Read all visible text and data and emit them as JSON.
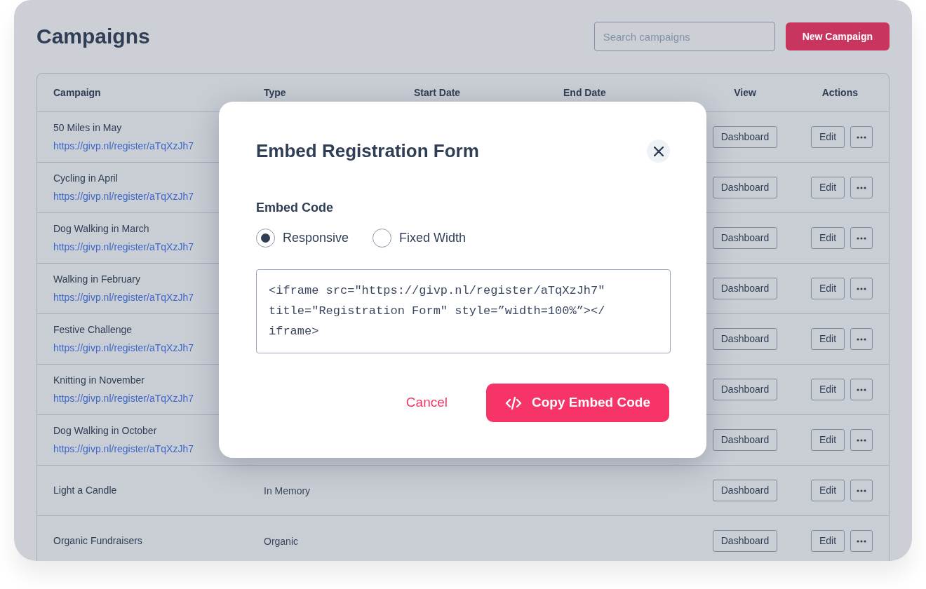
{
  "page": {
    "title": "Campaigns"
  },
  "search": {
    "placeholder": "Search campaigns"
  },
  "new_button": "New Campaign",
  "table": {
    "columns": [
      "Campaign",
      "Type",
      "Start Date",
      "End Date",
      "View",
      "Actions"
    ],
    "rows": [
      {
        "name": "50 Miles in May",
        "link": "https://givp.nl/register/aTqXzJh7",
        "view": "Dashboard",
        "edit": "Edit"
      },
      {
        "name": "Cycling in April",
        "link": "https://givp.nl/register/aTqXzJh7",
        "view": "Dashboard",
        "edit": "Edit"
      },
      {
        "name": "Dog Walking in March",
        "link": "https://givp.nl/register/aTqXzJh7",
        "view": "Dashboard",
        "edit": "Edit"
      },
      {
        "name": "Walking in February",
        "link": "https://givp.nl/register/aTqXzJh7",
        "view": "Dashboard",
        "edit": "Edit"
      },
      {
        "name": "Festive Challenge",
        "link": "https://givp.nl/register/aTqXzJh7",
        "view": "Dashboard",
        "edit": "Edit"
      },
      {
        "name": "Knitting in November",
        "link": "https://givp.nl/register/aTqXzJh7",
        "view": "Dashboard",
        "edit": "Edit"
      },
      {
        "name": "Dog Walking in October",
        "link": "https://givp.nl/register/aTqXzJh7",
        "view": "Dashboard",
        "edit": "Edit"
      },
      {
        "name": "Light a Candle",
        "type": "In Memory",
        "view": "Dashboard",
        "edit": "Edit"
      },
      {
        "name": "Organic Fundraisers",
        "type": "Organic",
        "view": "Dashboard",
        "edit": "Edit"
      }
    ]
  },
  "modal": {
    "title": "Embed Registration Form",
    "section_label": "Embed Code",
    "options": [
      {
        "label": "Responsive",
        "selected": true
      },
      {
        "label": "Fixed Width",
        "selected": false
      }
    ],
    "code_lines": [
      "<iframe src=\"https://givp.nl/register/aTqXzJh7\"",
      "title=\"Registration Form\" style=”width=100%”></",
      "iframe>"
    ],
    "cancel": "Cancel",
    "copy": "Copy Embed Code"
  }
}
